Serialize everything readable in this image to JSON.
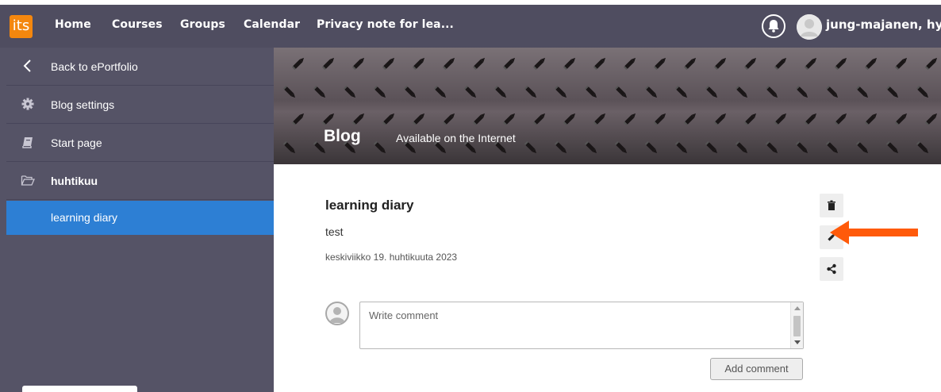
{
  "topbar": {
    "logo_text": "its",
    "nav": [
      "Home",
      "Courses",
      "Groups",
      "Calendar",
      "Privacy note for lea..."
    ],
    "user_name": "jung-majanen, hye",
    "accent_color": "#f4870e",
    "bar_color": "#4f4d60"
  },
  "sidebar": {
    "items": [
      {
        "label": "Back to ePortfolio",
        "icon": "chevron-left-icon"
      },
      {
        "label": "Blog settings",
        "icon": "gear-icon"
      },
      {
        "label": "Start page",
        "icon": "book-icon"
      },
      {
        "label": "huhtikuu",
        "icon": "folder-open-icon"
      },
      {
        "label": "learning diary",
        "icon": "",
        "active": true
      }
    ],
    "active_color": "#2d7fd4"
  },
  "banner": {
    "title": "Blog",
    "subtitle": "Available on the Internet"
  },
  "post": {
    "title": "learning diary",
    "body": "test",
    "date": "keskiviikko 19. huhtikuuta 2023"
  },
  "actions": [
    "trash-icon",
    "pencil-icon",
    "share-icon"
  ],
  "annotation": {
    "arrow_color": "#ff5a0a",
    "points_to": "pencil-icon"
  },
  "comment": {
    "placeholder": "Write comment",
    "submit_label": "Add comment"
  }
}
